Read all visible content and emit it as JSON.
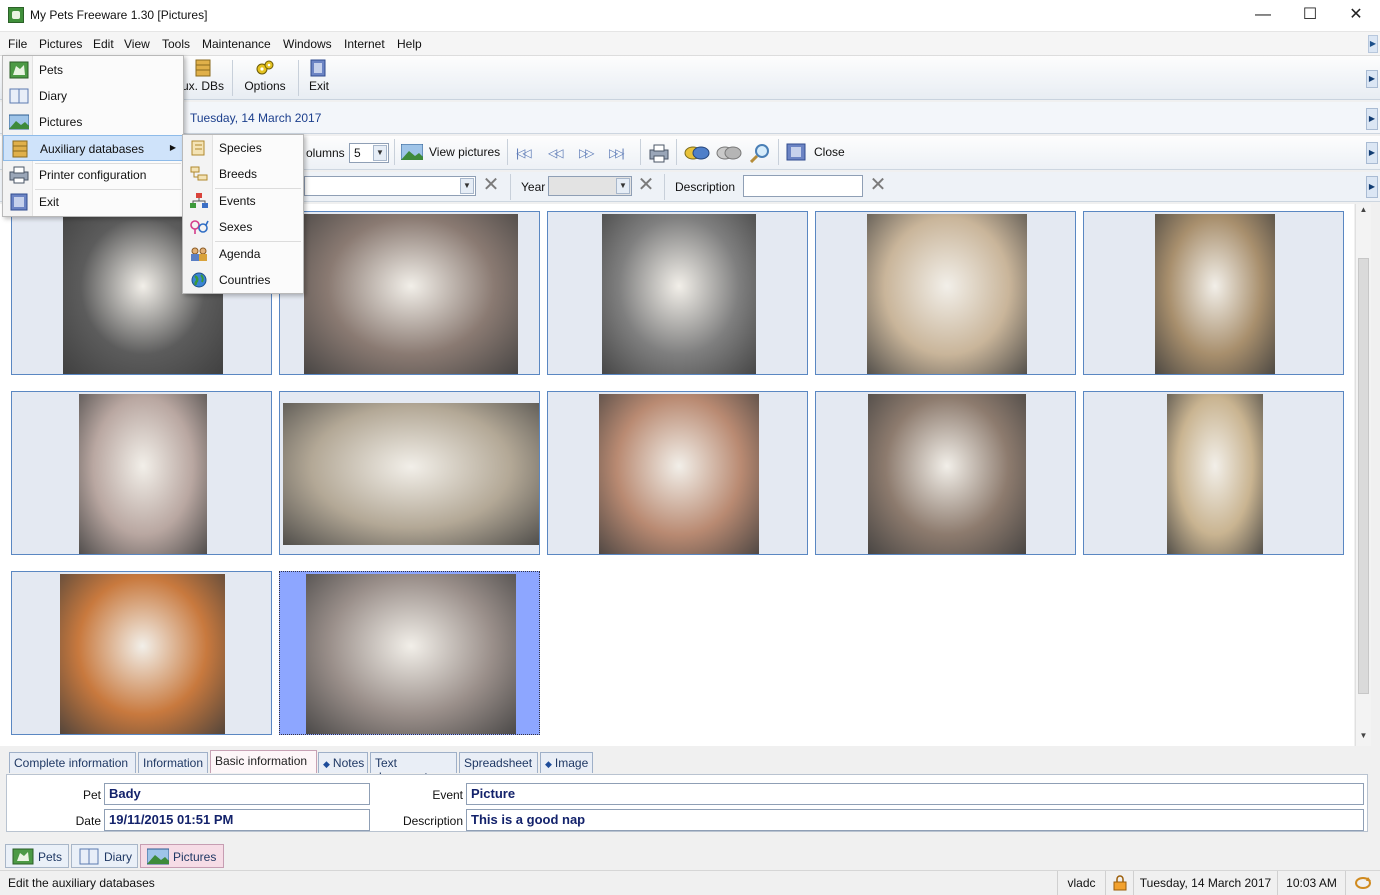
{
  "window": {
    "title": "My Pets Freeware 1.30 [Pictures]",
    "minimize": "—",
    "maximize": "☐",
    "close": "✕"
  },
  "menubar": {
    "items": [
      "File",
      "Pictures",
      "Edit",
      "View",
      "Tools",
      "Maintenance",
      "Windows",
      "Internet",
      "Help"
    ]
  },
  "toolbar": {
    "aux_dbs": "ux. DBs",
    "options": "Options",
    "exit": "Exit"
  },
  "datebar": {
    "date": "Tuesday, 14 March 2017"
  },
  "picture_toolbar": {
    "columns_label": "olumns",
    "columns_value": "5",
    "view_pictures": "View pictures",
    "close": "Close",
    "nav_first": "|◁◁",
    "nav_prev": "◁◁",
    "nav_next": "▷▷",
    "nav_last": "▷▷|"
  },
  "filterbar": {
    "year_label": "Year",
    "year_value": "",
    "description_label": "Description",
    "description_value": ""
  },
  "gallery": {
    "columns": 5,
    "selected_index": 11,
    "pictures": [
      {
        "subject": "black-white-shih-tzu-portrait",
        "color": "#5c5c5c"
      },
      {
        "subject": "dog-on-striped-cushion",
        "color": "#8a7a72"
      },
      {
        "subject": "dog-closeup-bw",
        "color": "#7f7f7f"
      },
      {
        "subject": "dog-with-monster-sticker",
        "color": "#c9b59a"
      },
      {
        "subject": "shaggy-dog-on-tiles",
        "color": "#a88f6d"
      },
      {
        "subject": "dog-with-cone-collar",
        "color": "#b9a7a1"
      },
      {
        "subject": "dogs-with-plush-toys",
        "color": "#b3a896"
      },
      {
        "subject": "cream-dog-profile",
        "color": "#b98a72"
      },
      {
        "subject": "small-dog-on-plaid-chair",
        "color": "#8d7b6e"
      },
      {
        "subject": "cream-dog-on-blanket",
        "color": "#c9b491"
      },
      {
        "subject": "sleeping-dog-orange",
        "color": "#c8793e"
      },
      {
        "subject": "dog-napping-on-cushion",
        "color": "#9a8f8a"
      }
    ]
  },
  "tabs": {
    "items": [
      {
        "label": "Complete information",
        "dot": false
      },
      {
        "label": "Information",
        "dot": false
      },
      {
        "label": "Basic information",
        "dot": false
      },
      {
        "label": "Notes",
        "dot": true
      },
      {
        "label": "Text document",
        "dot": false
      },
      {
        "label": "Spreadsheet",
        "dot": false
      },
      {
        "label": "Image",
        "dot": true
      }
    ],
    "active": "Basic information"
  },
  "info": {
    "pet_label": "Pet",
    "pet_value": "Bady",
    "date_label": "Date",
    "date_value": "19/11/2015 01:51 PM",
    "event_label": "Event",
    "event_value": "Picture",
    "description_label": "Description",
    "description_value": "This is a good nap"
  },
  "window_tabs": [
    {
      "label": "Pets",
      "active": false
    },
    {
      "label": "Diary",
      "active": false
    },
    {
      "label": "Pictures",
      "active": true
    }
  ],
  "statusbar": {
    "message": "Edit the auxiliary databases",
    "user": "vladc",
    "date": "Tuesday, 14 March 2017",
    "time": "10:03 AM"
  },
  "file_menu": {
    "items": [
      "Pets",
      "Diary",
      "Pictures",
      "Auxiliary databases",
      "Printer configuration",
      "Exit"
    ],
    "highlighted": "Auxiliary databases"
  },
  "aux_submenu": {
    "items": [
      "Species",
      "Breeds",
      "Events",
      "Sexes",
      "Agenda",
      "Countries"
    ]
  },
  "colors": {
    "accent": "#1c3f8d",
    "cell_border": "#5a87c2",
    "selected_cell": "#8da6ff",
    "active_tab": "#f6dce6"
  }
}
